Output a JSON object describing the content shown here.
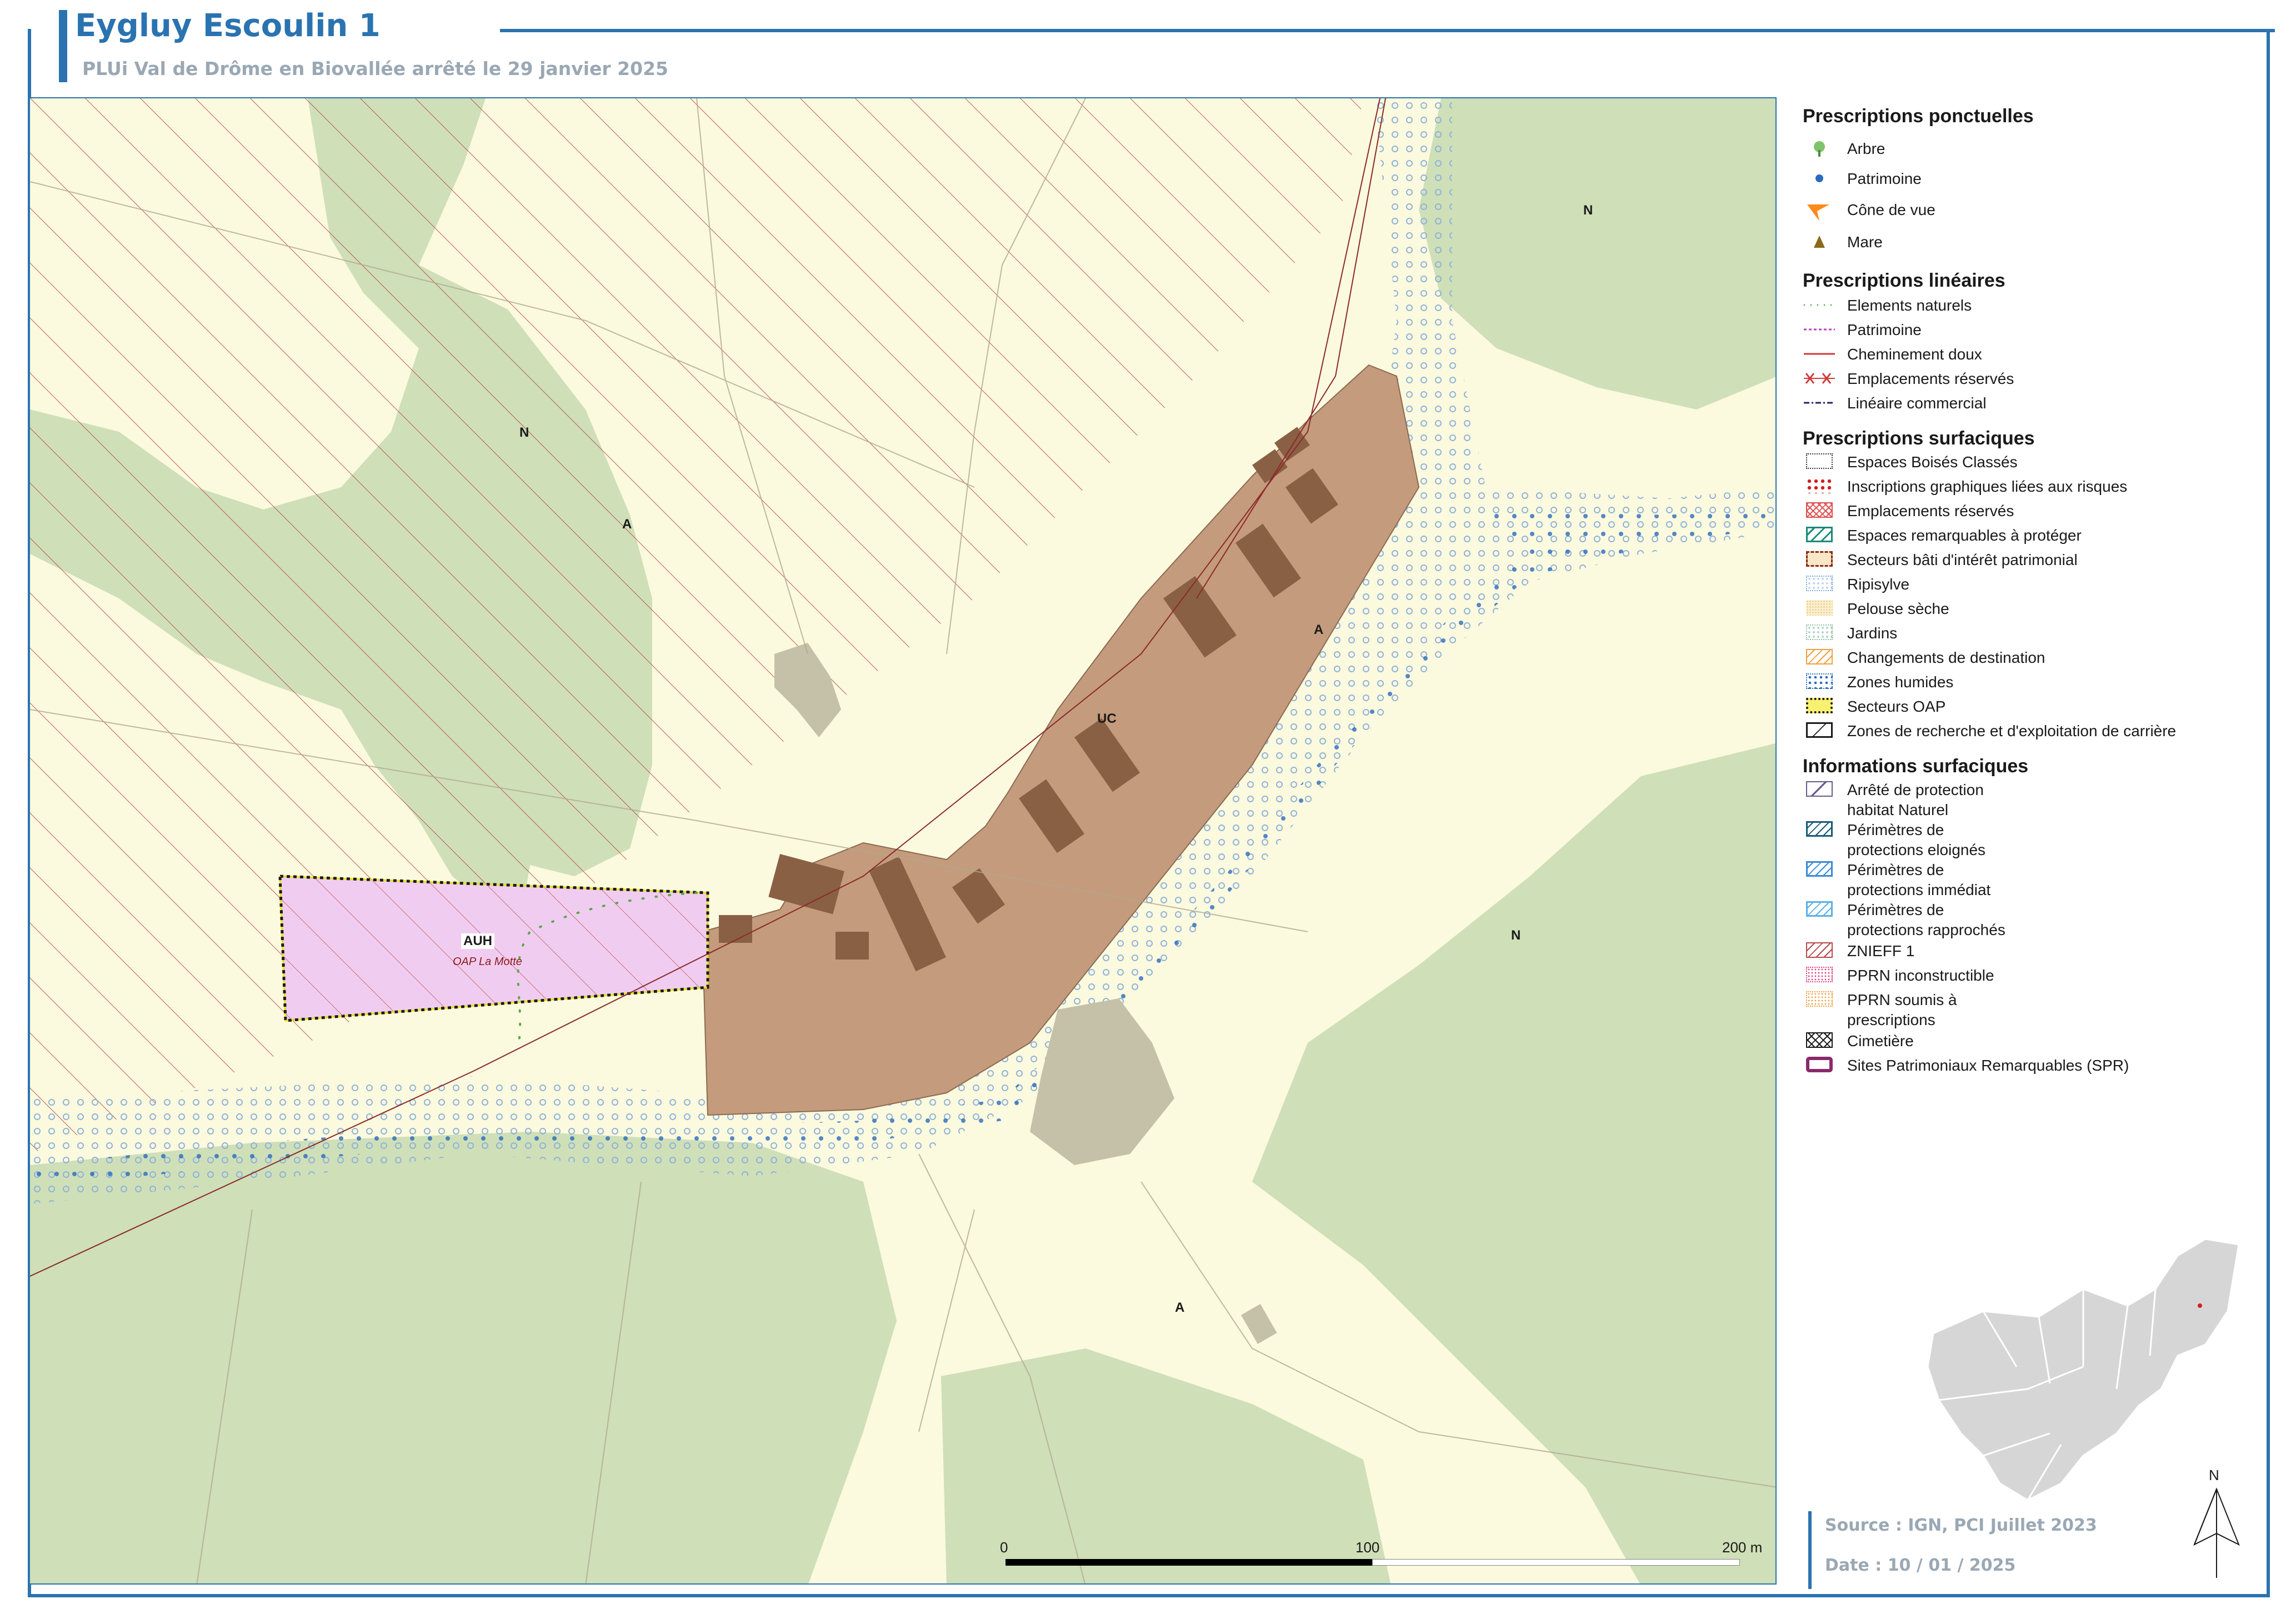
{
  "header": {
    "title": "Eygluy Escoulin 1",
    "subtitle": "PLUi Val de Drôme en Biovallée arrêté le 29 janvier 2025"
  },
  "map": {
    "zone_labels": [
      "N",
      "A",
      "N",
      "UC",
      "A",
      "N",
      "A",
      "AUH"
    ],
    "oap_label": "OAP La Motte",
    "scale": {
      "labels": [
        "0",
        "100",
        "200 m"
      ]
    },
    "north_label": "N"
  },
  "legend": {
    "ponctuelles": {
      "title": "Prescriptions ponctuelles",
      "items": [
        "Arbre",
        "Patrimoine",
        "Cône de vue",
        "Mare"
      ]
    },
    "lineaires": {
      "title": "Prescriptions linéaires",
      "items": [
        "Elements naturels",
        "Patrimoine",
        "Cheminement doux",
        "Emplacements réservés",
        "Linéaire commercial"
      ]
    },
    "surfaciques": {
      "title": "Prescriptions surfaciques",
      "items": [
        "Espaces Boisés Classés",
        "Inscriptions graphiques liées aux risques",
        "Emplacements réservés",
        "Espaces remarquables à protéger",
        "Secteurs bâti d'intérêt patrimonial",
        "Ripisylve",
        "Pelouse sèche",
        "Jardins",
        "Changements de destination",
        "Zones humides",
        "Secteurs OAP",
        "Zones de recherche et d'exploitation de carrière"
      ]
    },
    "informations": {
      "title": "Informations surfaciques",
      "items": [
        [
          "Arrêté de protection",
          "habitat Naturel"
        ],
        [
          "Périmètres de",
          "protections eloignés"
        ],
        [
          "Périmètres de",
          "protections immédiat"
        ],
        [
          "Périmètres de",
          "protections rapprochés"
        ],
        [
          "ZNIEFF 1"
        ],
        [
          "PPRN inconstructible"
        ],
        [
          "PPRN soumis à",
          "prescriptions"
        ],
        [
          "Cimetière"
        ],
        [
          "Sites Patrimoniaux Remarquables (SPR)"
        ]
      ]
    }
  },
  "footer": {
    "source": "Source : IGN, PCI Juillet 2023",
    "date": "Date : 10 / 01 / 2025"
  }
}
